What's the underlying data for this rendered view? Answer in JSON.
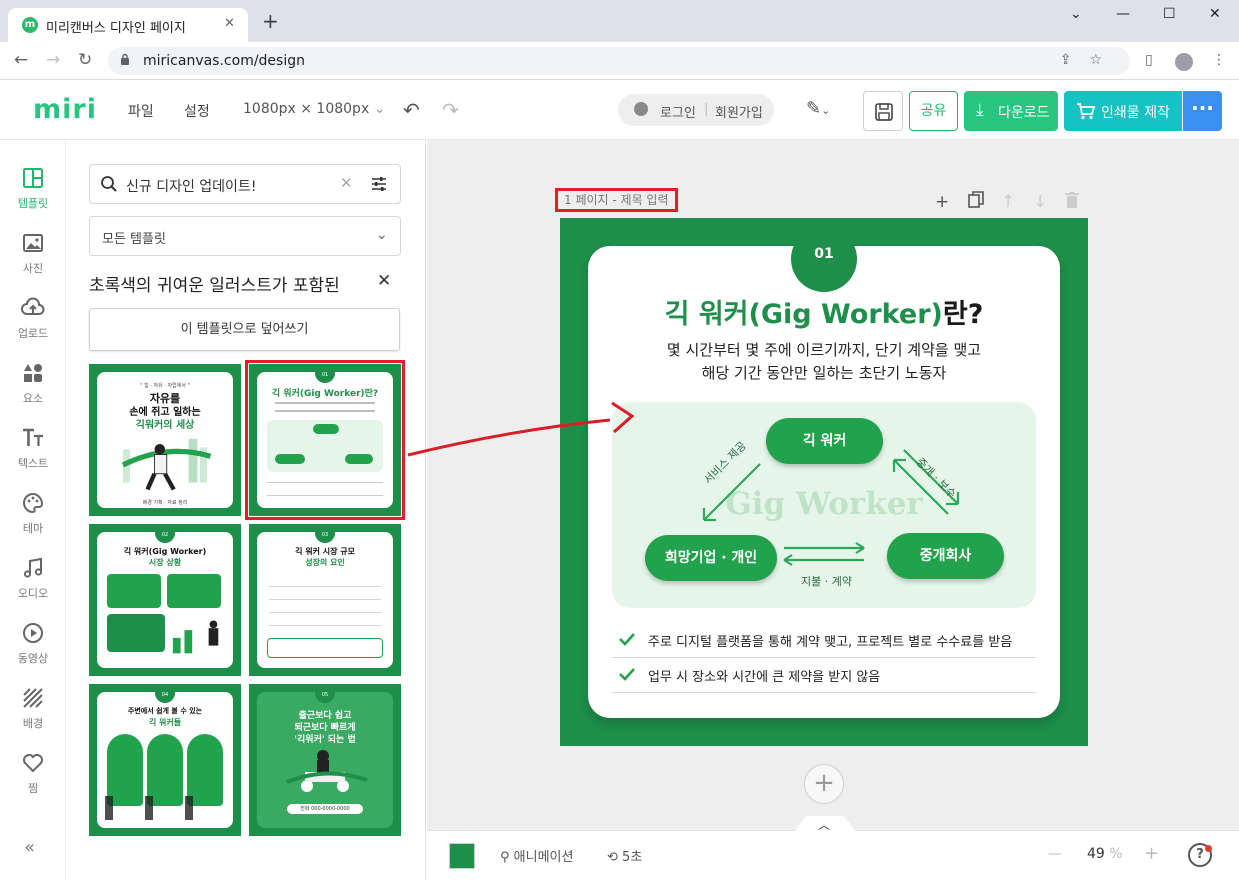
{
  "browser": {
    "tab_title": "미리캔버스 디자인 페이지",
    "favicon_letter": "m",
    "url": "miricanvas.com/design"
  },
  "header": {
    "logo": "miri",
    "menu": [
      "파일",
      "설정"
    ],
    "canvas_size": "1080px × 1080px",
    "login": "로그인",
    "signup": "회원가입",
    "share": "공유",
    "download": "다운로드",
    "print": "인쇄물 제작"
  },
  "rail": {
    "items": [
      {
        "label": "템플릿",
        "icon": "template-icon"
      },
      {
        "label": "사진",
        "icon": "photo-icon"
      },
      {
        "label": "업로드",
        "icon": "upload-icon"
      },
      {
        "label": "요소",
        "icon": "elements-icon"
      },
      {
        "label": "텍스트",
        "icon": "text-icon"
      },
      {
        "label": "테마",
        "icon": "palette-icon"
      },
      {
        "label": "오디오",
        "icon": "music-icon"
      },
      {
        "label": "동영상",
        "icon": "video-icon"
      },
      {
        "label": "배경",
        "icon": "background-icon"
      },
      {
        "label": "찜",
        "icon": "heart-icon"
      }
    ],
    "collapse": "«"
  },
  "panel": {
    "search_value": "신규 디자인 업데이트!",
    "filter": "모든 템플릿",
    "title": "초록색의 귀여운 일러스트가 포함된",
    "overwrite": "이 템플릿으로 덮어쓰기",
    "thumbs": [
      {
        "title_a": "자유를",
        "title_b": "손에 쥐고 일하는",
        "title_c": "긱워커의 세상",
        "tag": "\" 힘 · 자유 · 자립에서 \"",
        "num": "",
        "foot": "배경 기획 · 자료 정리"
      },
      {
        "title_a": "",
        "title_b": "긱 워커(Gig Worker)란?",
        "title_c": "",
        "tag": "",
        "num": "01",
        "foot": ""
      },
      {
        "title_a": "",
        "title_b": "긱 워커(Gig Worker)",
        "title_c": "시장 상황",
        "tag": "",
        "num": "02",
        "foot": ""
      },
      {
        "title_a": "",
        "title_b": "긱 워커 시장 규모",
        "title_c": "성장의 요인",
        "tag": "",
        "num": "03",
        "foot": ""
      },
      {
        "title_a": "",
        "title_b": "주변에서 쉽게 볼 수 있는",
        "title_c": "긱 워커들",
        "tag": "",
        "num": "04",
        "foot": ""
      },
      {
        "title_a": "",
        "title_b": "출근보다 쉽고",
        "title_c": "퇴근보다 빠르게",
        "tag": "'긱워커' 되는 법",
        "num": "05",
        "foot": "전화 000-0000-0000"
      }
    ]
  },
  "canvas": {
    "page_label": "1 페이지 - 제목 입력",
    "number": "01",
    "title_green": "긱 워커(Gig Worker)",
    "title_black": "란?",
    "sub1": "몇 시간부터 몇 주에 이르기까지, 단기 계약을 맺고",
    "sub2": "해당 기간 동안만 일하는 초단기 노동자",
    "watermark": "Gig Worker",
    "node_top": "긱 워커",
    "node_left": "희망기업 · 개인",
    "node_right": "중개회사",
    "label_service": "서비스 제공",
    "label_fee": "중개 · 보수",
    "label_payment": "지불 · 계약",
    "check1": "주로 디지털 플랫폼을 통해 계약 맺고, 프로젝트 별로 수수료를 받음",
    "check2": "업무 시 장소와 시간에 큰 제약을 받지 않음"
  },
  "bottom": {
    "animation": "애니메이션",
    "duration": "5초",
    "zoom": "49",
    "zoom_unit": "%",
    "help": "?"
  },
  "colors": {
    "brand_green": "#27c580",
    "canvas_green": "#1e8f4a",
    "print_cyan": "#16c3c3",
    "more_blue": "#3b8ff0",
    "highlight_red": "#e01f26"
  }
}
